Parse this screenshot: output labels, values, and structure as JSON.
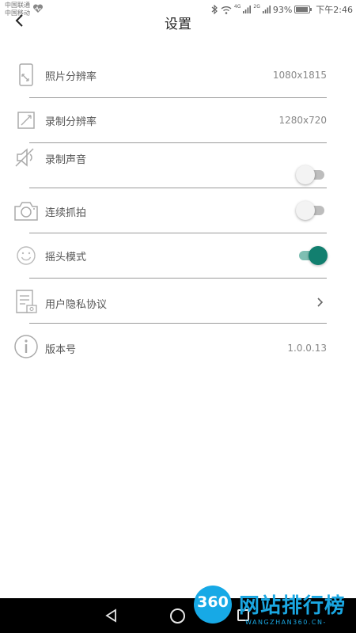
{
  "status_bar": {
    "carrier_line1": "中国联通",
    "carrier_line2": "中国移动",
    "network_4g": "4G",
    "network_2g": "2G",
    "battery": "93%",
    "battery_level": 0.93,
    "time": "下午2:46"
  },
  "header": {
    "title": "设置"
  },
  "settings": {
    "photo_resolution": {
      "label": "照片分辨率",
      "value": "1080x1815",
      "icon": "phone-icon"
    },
    "record_resolution": {
      "label": "录制分辨率",
      "value": "1280x720",
      "icon": "resize-icon"
    },
    "record_sound": {
      "label": "录制声音",
      "on": false,
      "icon": "speaker-muted-icon"
    },
    "burst_shot": {
      "label": "连续抓拍",
      "on": false,
      "icon": "camera-icon"
    },
    "head_shake_mode": {
      "label": "摇头模式",
      "on": true,
      "icon": "smile-icon"
    },
    "privacy_policy": {
      "label": "用户隐私协议",
      "icon": "document-icon"
    },
    "version": {
      "label": "版本号",
      "value": "1.0.0.13",
      "icon": "info-icon"
    }
  },
  "colors": {
    "toggle_on_thumb": "#127f6f",
    "toggle_on_track": "#7fbfb3",
    "toggle_off_track": "#bdbdbd",
    "watermark": "#1aa7e2"
  },
  "watermark": {
    "number": "360",
    "text": "网站排行榜",
    "sub": "WANGZHAN360.CN-"
  }
}
